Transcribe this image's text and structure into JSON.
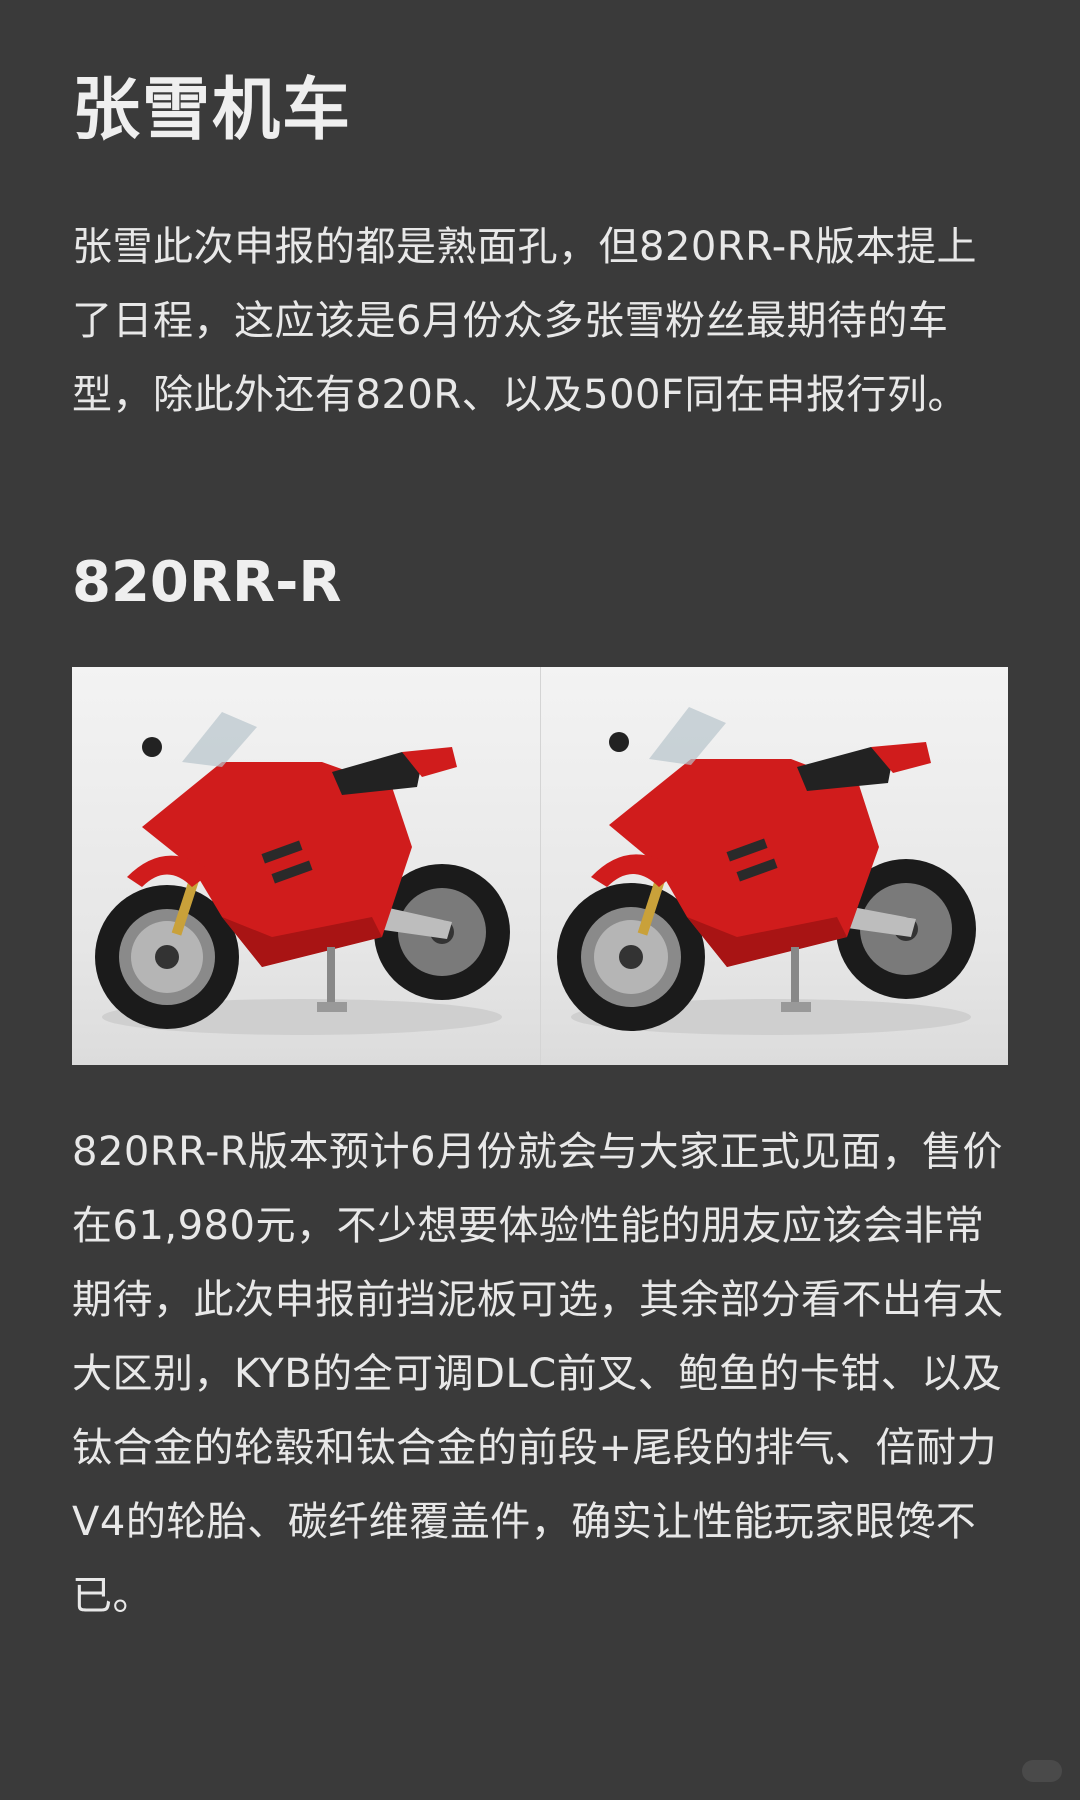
{
  "article": {
    "title": "张雪机车",
    "intro": "张雪此次申报的都是熟面孔，但820RR-R版本提上了日程，这应该是6月份众多张雪粉丝最期待的车型，除此外还有820R、以及500F同在申报行列。",
    "section_title": "820RR-R",
    "body": "820RR-R版本预计6月份就会与大家正式见面，售价在61,980元，不少想要体验性能的朋友应该会非常期待，此次申报前挡泥板可选，其余部分看不出有太大区别，KYB的全可调DLC前叉、鲍鱼的卡钳、以及钛合金的轮毂和钛合金的前段+尾段的排气、倍耐力V4的轮胎、碳纤维覆盖件，确实让性能玩家眼馋不已。"
  },
  "photo": {
    "subject": "red sport motorcycle",
    "views": [
      "left-front view",
      "left-front view alternate"
    ]
  },
  "colors": {
    "background": "#3a3a3a",
    "text": "#ececec",
    "bike_red": "#d01c1c"
  }
}
